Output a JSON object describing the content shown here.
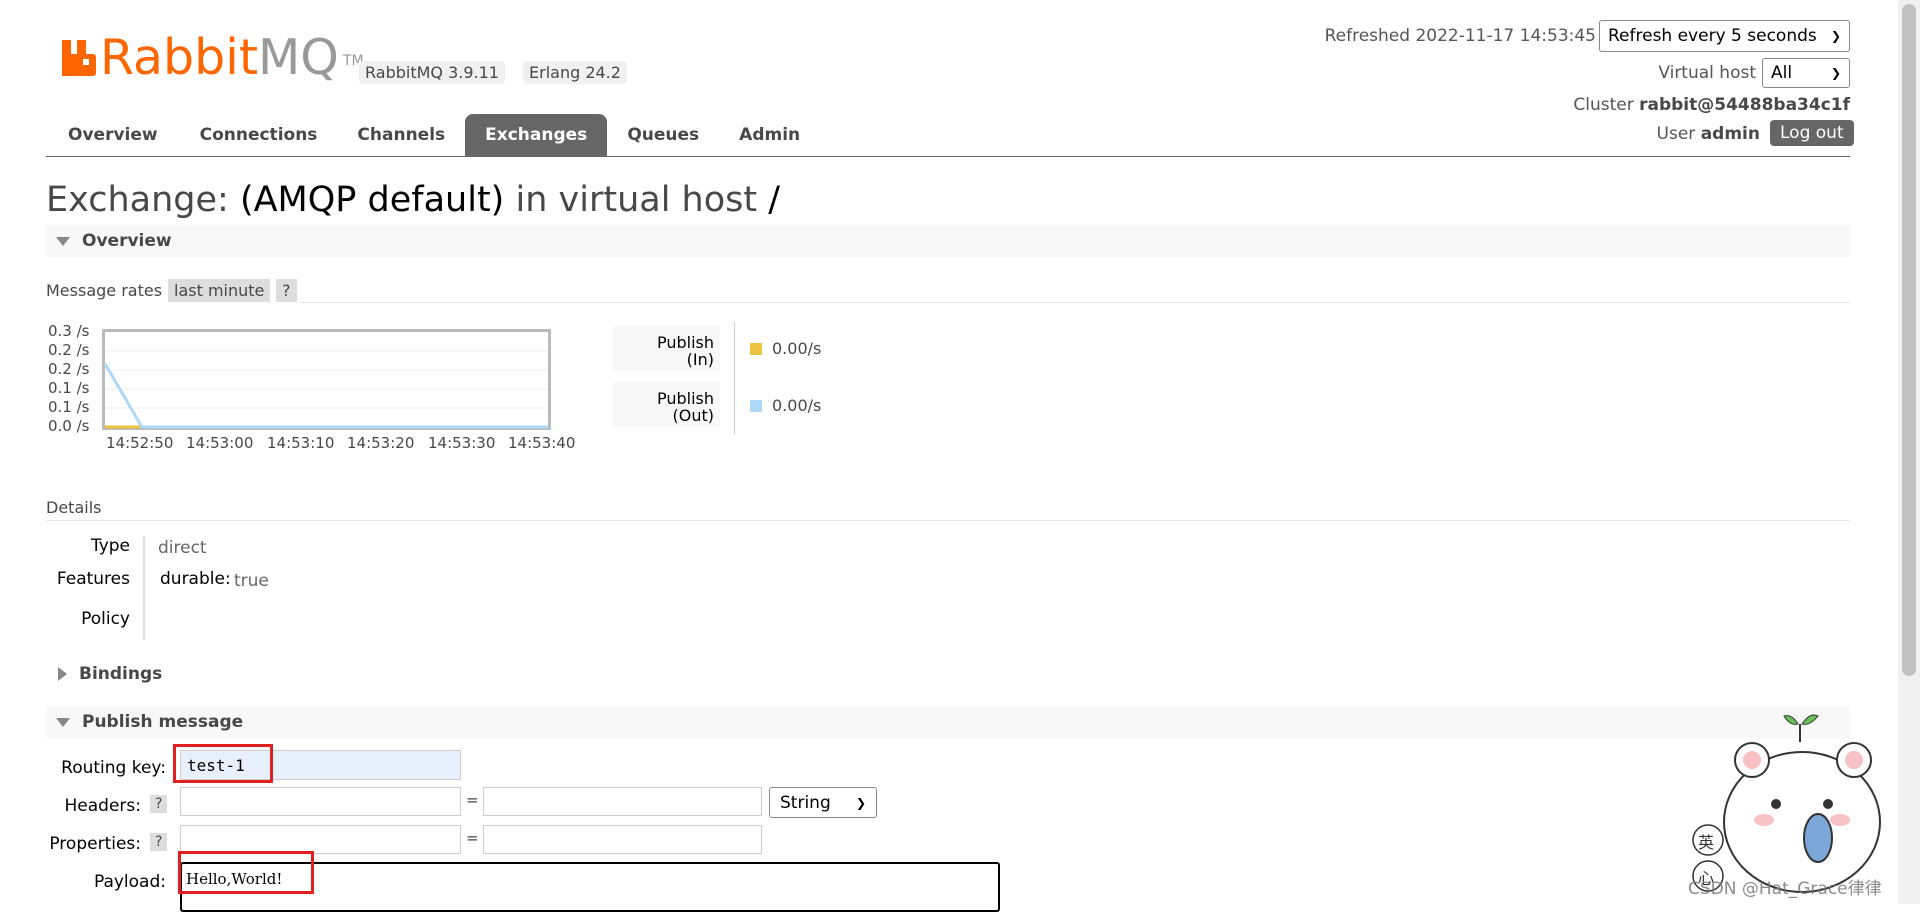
{
  "header": {
    "brand_rabbit": "Rabbit",
    "brand_mq": "MQ",
    "brand_tm": "TM",
    "version_rabbitmq": "RabbitMQ 3.9.11",
    "version_erlang": "Erlang 24.2",
    "refreshed_label": "Refreshed 2022-11-17 14:53:45",
    "refresh_select": "Refresh every 5 seconds",
    "virtual_host_label": "Virtual host",
    "virtual_host_value": "All",
    "cluster_label": "Cluster",
    "cluster_value": "rabbit@54488ba34c1f",
    "user_label": "User",
    "user_value": "admin",
    "logout_label": "Log out"
  },
  "tabs": [
    {
      "label": "Overview"
    },
    {
      "label": "Connections"
    },
    {
      "label": "Channels"
    },
    {
      "label": "Exchanges",
      "active": true
    },
    {
      "label": "Queues"
    },
    {
      "label": "Admin"
    }
  ],
  "page": {
    "title_prefix": "Exchange:",
    "title_name": "(AMQP default)",
    "title_mid": "in virtual host",
    "title_vhost": "/"
  },
  "overview": {
    "section_label": "Overview",
    "message_rates_label": "Message rates",
    "range_chip": "last minute",
    "help": "?",
    "y_ticks": [
      "0.3 /s",
      "0.2 /s",
      "0.2 /s",
      "0.1 /s",
      "0.1 /s",
      "0.0 /s"
    ],
    "x_ticks": [
      "14:52:50",
      "14:53:00",
      "14:53:10",
      "14:53:20",
      "14:53:30",
      "14:53:40"
    ],
    "legend": [
      {
        "label_line1": "Publish",
        "label_line2": "(In)",
        "value": "0.00/s",
        "color": "#edc240"
      },
      {
        "label_line1": "Publish",
        "label_line2": "(Out)",
        "value": "0.00/s",
        "color": "#afd8f8"
      }
    ]
  },
  "chart_data": {
    "type": "line",
    "x": [
      "14:52:45",
      "14:52:50",
      "14:53:00",
      "14:53:10",
      "14:53:20",
      "14:53:30",
      "14:53:40",
      "14:53:45"
    ],
    "series": [
      {
        "name": "Publish (In)",
        "values": [
          0,
          0,
          0,
          0,
          0,
          0,
          0,
          0
        ],
        "color": "#edc240"
      },
      {
        "name": "Publish (Out)",
        "values": [
          0.2,
          0,
          0,
          0,
          0,
          0,
          0,
          0
        ],
        "color": "#afd8f8"
      }
    ],
    "ylim": [
      0,
      0.3
    ]
  },
  "details": {
    "section_label": "Details",
    "type_label": "Type",
    "type_value": "direct",
    "features_label": "Features",
    "features_key": "durable:",
    "features_value": "true",
    "policy_label": "Policy"
  },
  "bindings": {
    "section_label": "Bindings"
  },
  "publish": {
    "section_label": "Publish message",
    "routing_key_label": "Routing key:",
    "routing_key_value": "test-1",
    "headers_label": "Headers:",
    "properties_label": "Properties:",
    "help": "?",
    "equals": "=",
    "header_type": "String",
    "payload_label": "Payload:",
    "payload_value": "Hello,World!"
  },
  "watermark": "CSDN @Hat_Grace律律",
  "sticker_chars": [
    "英",
    "心"
  ]
}
